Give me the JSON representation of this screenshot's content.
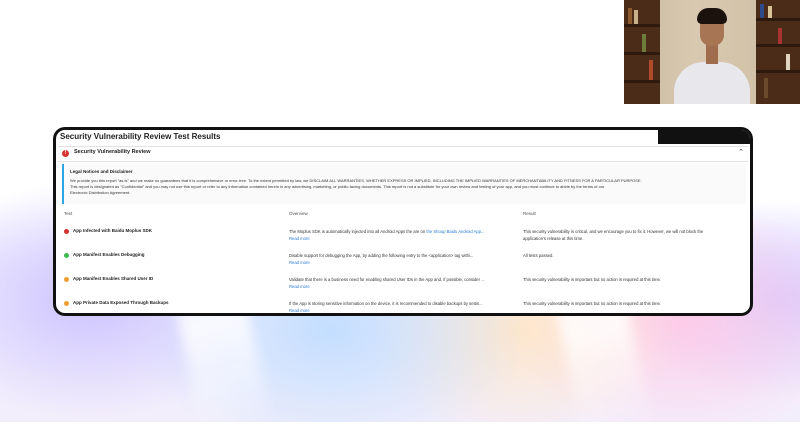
{
  "page": {
    "title": "Security Vulnerability Review Test Results",
    "section": {
      "label": "Security Vulnerability Review",
      "icon": "error-icon",
      "toggle_icon": "chevron-up-icon"
    },
    "legal": {
      "title": "Legal Notices and Disclaimer",
      "lines": [
        "We provide you this report \"as is\" and we make no guarantees that it is comprehensive or error-free. To the extent permitted by law, we DISCLAIM ALL WARRANTIES, WHETHER EXPRESS OR IMPLIED, INCLUDING THE IMPLIED WARRANTIES OF MERCHANTABILITY AND FITNESS FOR A PARTICULAR PURPOSE.",
        "This report is designated as \"Confidential\" and you may not use this report or refer to any information contained herein in any advertising, marketing, or public-facing documents. This report is not a substitute for your own review and testing of your app, and you must continue to abide by the terms of our",
        "Electronic Distribution Agreement."
      ]
    },
    "columns": {
      "test": "Test",
      "overview": "Overview",
      "result": "Result"
    },
    "read_more_label": "Read more",
    "rows": [
      {
        "status": "critical",
        "color": "#d6302f",
        "name": "App Infected with Baidu Moplus SDK",
        "overview": "The Moplus SDK is automatically injected into all Android Apps the are on ",
        "overview_link": "the Shoup Baidu Android App...",
        "result": "This security vulnerability is critical, and we encourage you to fix it. However, we will not block the application's release at this time."
      },
      {
        "status": "passed",
        "color": "#3fb950",
        "name": "App Manifest Enables Debugging",
        "overview": "Disable support for debugging the App, by adding the following entry to the <application> tag withi...",
        "overview_link": "",
        "result": "All tests passed."
      },
      {
        "status": "important",
        "color": "#f0a030",
        "name": "App Manifest Enables Shared User ID",
        "overview": "Validate that there is a business need for enabling shared User IDs in the App and, if possible, consider ...",
        "overview_link": "",
        "result": "This security vulnerability is important but no action is required at this time."
      },
      {
        "status": "important",
        "color": "#f0a030",
        "name": "App Private Data Exposed Through Backups",
        "overview": "If the App is storing sensitive information on the device, it is recommended to disable backups by settin...",
        "overview_link": "",
        "result": "This security vulnerability is important but no action is required at this time."
      }
    ]
  },
  "webcam": {
    "icon": "presenter-video"
  }
}
